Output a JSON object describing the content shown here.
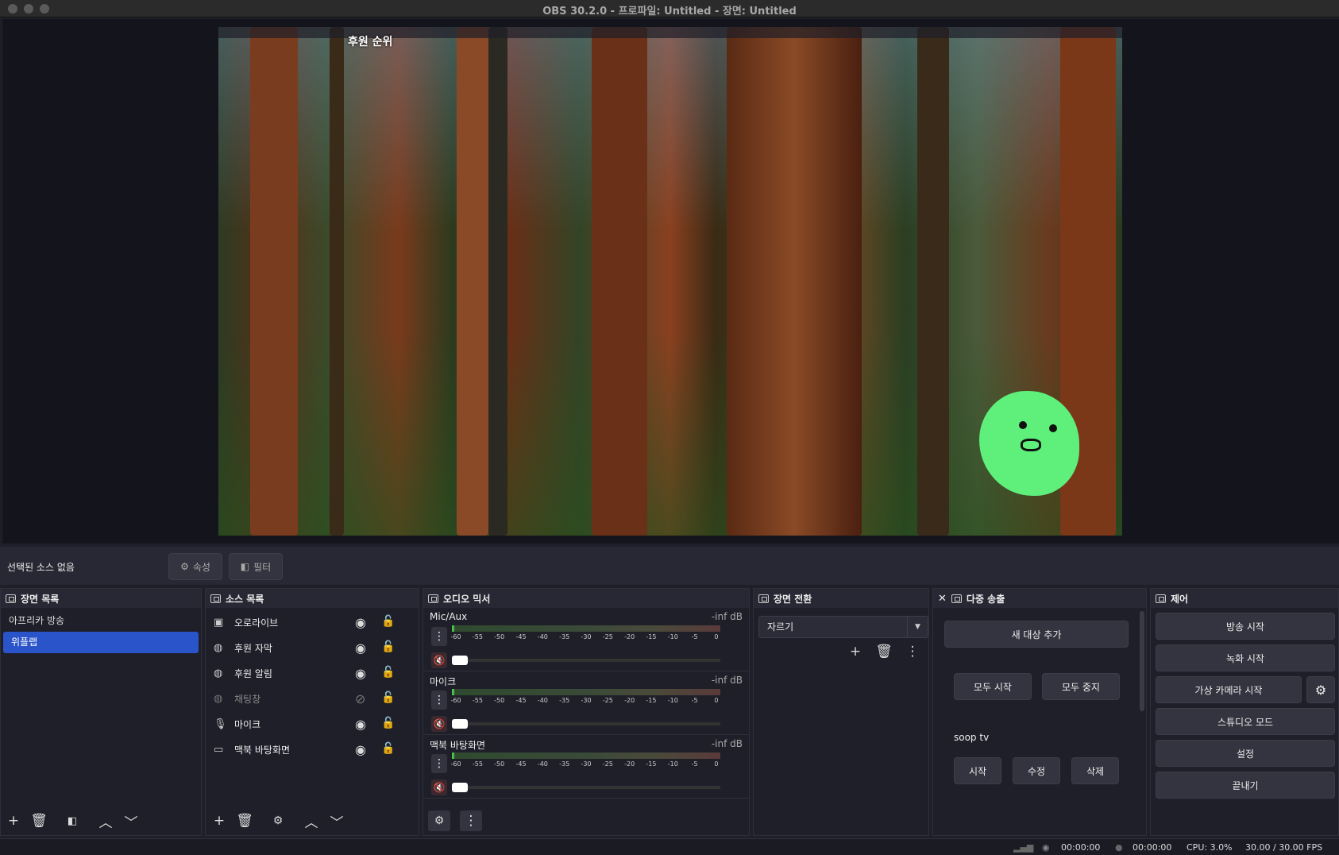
{
  "window": {
    "title": "OBS 30.2.0 - 프로파일: Untitled - 장면: Untitled"
  },
  "preview": {
    "overlay_text": "후원 순위"
  },
  "toolbar": {
    "no_source": "선택된 소스 없음",
    "properties": "속성",
    "filters": "필터"
  },
  "scenes": {
    "title": "장면 목록",
    "items": [
      {
        "label": "아프리카 방송",
        "selected": false
      },
      {
        "label": "위플랩",
        "selected": true
      }
    ]
  },
  "sources": {
    "title": "소스 목록",
    "items": [
      {
        "label": "오로라이브",
        "icon": "image-icon",
        "visible": true
      },
      {
        "label": "후원 자막",
        "icon": "globe-icon",
        "visible": true
      },
      {
        "label": "후원 알림",
        "icon": "globe-icon",
        "visible": true
      },
      {
        "label": "채팅창",
        "icon": "globe-icon",
        "visible": false
      },
      {
        "label": "마이크",
        "icon": "microphone-icon",
        "visible": true
      },
      {
        "label": "맥북 바탕화면",
        "icon": "monitor-icon",
        "visible": true
      }
    ]
  },
  "mixer": {
    "title": "오디오 믹서",
    "scale": [
      "-60",
      "-55",
      "-50",
      "-45",
      "-40",
      "-35",
      "-30",
      "-25",
      "-20",
      "-15",
      "-10",
      "-5",
      "0"
    ],
    "channels": [
      {
        "name": "Mic/Aux",
        "db": "-inf dB"
      },
      {
        "name": "마이크",
        "db": "-inf dB"
      },
      {
        "name": "맥북 바탕화면",
        "db": "-inf dB"
      }
    ]
  },
  "transitions": {
    "title": "장면 전환",
    "selected": "자르기"
  },
  "multistream": {
    "title": "다중 송출",
    "add_target": "새 대상 추가",
    "start_all": "모두 시작",
    "stop_all": "모두 중지",
    "target_name": "soop tv",
    "start": "시작",
    "edit": "수정",
    "delete": "삭제"
  },
  "controls": {
    "title": "제어",
    "start_stream": "방송 시작",
    "start_record": "녹화 시작",
    "virtual_cam": "가상 카메라 시작",
    "studio_mode": "스튜디오 모드",
    "settings": "설정",
    "exit": "끝내기"
  },
  "statusbar": {
    "stream_time": "00:00:00",
    "record_time": "00:00:00",
    "cpu": "CPU: 3.0%",
    "fps": "30.00 / 30.00 FPS"
  }
}
